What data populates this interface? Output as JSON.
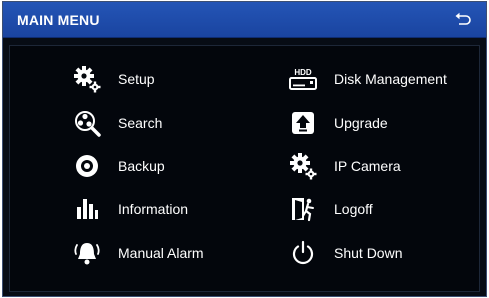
{
  "header": {
    "title": "MAIN MENU"
  },
  "menu": {
    "left": [
      {
        "label": "Setup",
        "icon": "gears-icon"
      },
      {
        "label": "Search",
        "icon": "search-icon"
      },
      {
        "label": "Backup",
        "icon": "disc-icon"
      },
      {
        "label": "Information",
        "icon": "bar-chart-icon"
      },
      {
        "label": "Manual Alarm",
        "icon": "alarm-bell-icon"
      }
    ],
    "right": [
      {
        "label": "Disk Management",
        "icon": "hdd-icon",
        "icon_text": "HDD"
      },
      {
        "label": "Upgrade",
        "icon": "upgrade-icon"
      },
      {
        "label": "IP Camera",
        "icon": "gears-icon"
      },
      {
        "label": "Logoff",
        "icon": "exit-door-icon"
      },
      {
        "label": "Shut Down",
        "icon": "power-icon"
      }
    ]
  },
  "colors": {
    "title_bar": "#2455b6",
    "background": "#070c15",
    "text": "#ffffff"
  }
}
